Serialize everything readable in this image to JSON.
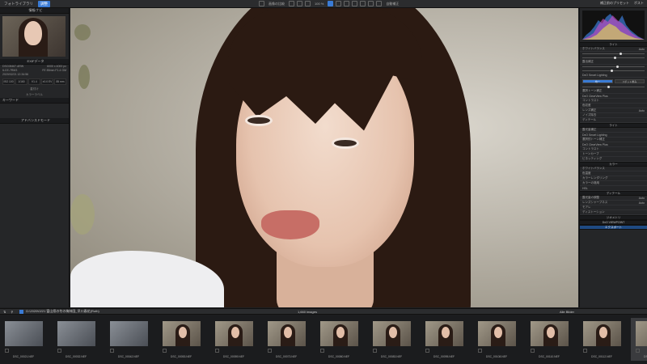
{
  "topbar": {
    "tabs": [
      "フォトライブラリ",
      "調整"
    ],
    "active_tab": 1,
    "center_label_1": "画像の比較",
    "center_label_2": "100 %",
    "center_label_3": "自動補正",
    "right_label_1": "補正前のプリセット",
    "right_label_2": "ポスト"
  },
  "left": {
    "info_title": "情報/ナビ",
    "exif_title": "EXIFデータ",
    "exif": {
      "file": "DSC08467.ARW",
      "size": "6000 x 4000 px",
      "camera": "ILCE-7RM3",
      "lens": "FE 85mm F1.4 GM",
      "date": "2020/02/21 12:34:56",
      "values": [
        "ISO 100",
        "1/160",
        "f/1.4",
        "±0.0 EV",
        "85 mm"
      ]
    },
    "keywords_title": "キーワード",
    "keyword_label": "星付け",
    "color_label": "カラーラベル",
    "advanced_title": "アドバンスドモード"
  },
  "right": {
    "sections": [
      "ホワイトバランス",
      "露出補正",
      "DxO Smart Lighting",
      "選択トーン補正",
      "DxO ClearView Plus",
      "コントラスト",
      "色収差",
      "レンズ補正",
      "ノイズ除去",
      "ディテール"
    ],
    "smart_buttons": [
      "均一",
      "スポット重み"
    ],
    "details_title": "ディテール",
    "details_items": [
      "露光量の調整",
      "レンズシャープネス",
      "モアレ",
      "ディストーション"
    ],
    "bottom_buttons": [
      "DxO VIEWPOINT",
      "エクスポート"
    ],
    "color_title": "カラー",
    "color_items": [
      "ホワイトバランス",
      "色温度",
      "カラーレンダリング",
      "カラーの適用",
      "HSL"
    ],
    "light_title": "ライト",
    "light_items": [
      "露光量補正",
      "DxO Smart Lighting",
      "選択的トーン補正",
      "DxO ClearView Plus",
      "コントラスト",
      "トーンカーブ",
      "ビネッティング"
    ],
    "geometry_title": "ジオメトリ",
    "auto_label": "Auto"
  },
  "filmbar": {
    "path": "D:\\2020\\0221 富山県の冬の梅林園_早川春花(Ruth)",
    "count": "1,660 images",
    "filter": "Alle Bilder"
  },
  "film": {
    "frames": [
      {
        "name": "DSC_00021.NEF",
        "type": "b"
      },
      {
        "name": "DSC_00032.NEF",
        "type": "b"
      },
      {
        "name": "DSC_00042.NEF",
        "type": "b"
      },
      {
        "name": "DSC_00053.NEF",
        "type": "p"
      },
      {
        "name": "DSC_00059.NEF",
        "type": "p"
      },
      {
        "name": "DSC_00073.NEF",
        "type": "p"
      },
      {
        "name": "DSC_00080.NEF",
        "type": "p"
      },
      {
        "name": "DSC_00083.NEF",
        "type": "p"
      },
      {
        "name": "DSC_00095.NEF",
        "type": "p"
      },
      {
        "name": "DSC_00108.NEF",
        "type": "p"
      },
      {
        "name": "DSC_00110.NEF",
        "type": "p"
      },
      {
        "name": "DSC_00112.NEF",
        "type": "p"
      },
      {
        "name": "DSC_00117.NEF",
        "type": "p",
        "selected": true
      }
    ]
  }
}
